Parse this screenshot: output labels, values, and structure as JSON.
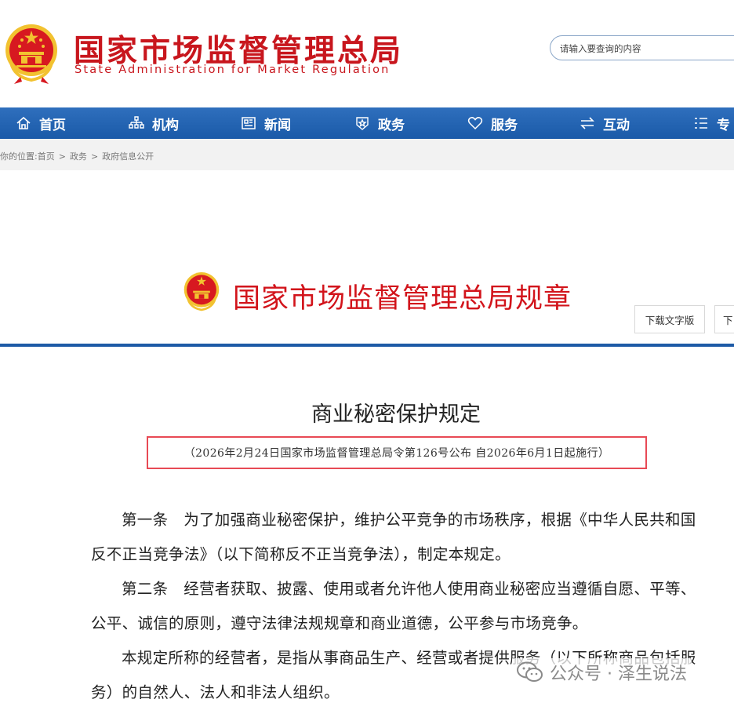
{
  "header": {
    "title": "国家市场监督管理总局",
    "subtitle": "State Administration for Market Regulation",
    "search": {
      "placeholder": "请输入要查询的内容"
    }
  },
  "nav": {
    "items": [
      {
        "label": "首页",
        "icon": "home-icon"
      },
      {
        "label": "机构",
        "icon": "org-chart-icon"
      },
      {
        "label": "新闻",
        "icon": "newspaper-icon"
      },
      {
        "label": "政务",
        "icon": "badge-icon"
      },
      {
        "label": "服务",
        "icon": "heart-icon"
      },
      {
        "label": "互动",
        "icon": "exchange-icon"
      },
      {
        "label": "专",
        "icon": "list-icon"
      }
    ]
  },
  "breadcrumb": {
    "prefix": "你的位置:",
    "items": [
      "首页",
      "政务",
      "政府信息公开"
    ],
    "separator": ">"
  },
  "rules_banner": {
    "title": "国家市场监督管理总局规章",
    "download_text_label": "下载文字版",
    "download_other_label": "下"
  },
  "document": {
    "title": "商业秘密保护规定",
    "meta": "（2026年2月24日国家市场监督管理总局令第126号公布  自2026年6月1日起施行）",
    "paragraphs": [
      "第一条　为了加强商业秘密保护，维护公平竞争的市场秩序，根据《中华人民共和国反不正当竞争法》（以下简称反不正当竞争法），制定本规定。",
      "第二条　经营者获取、披露、使用或者允许他人使用商业秘密应当遵循自愿、平等、公平、诚信的原则，遵守法律法规规章和商业道德，公平参与市场竞争。",
      "本规定所称的经营者，是指从事商品生产、经营或者提供服务（以下所称商品包括服务）的自然人、法人和非法人组织。"
    ]
  },
  "watermark": {
    "text": "公众号 · 泽生说法",
    "icon": "wechat-icon"
  },
  "colors": {
    "brand_red": "#c8161d",
    "nav_blue": "#1a5aa8",
    "highlight_box": "#e84a55",
    "emblem_gold": "#f2c230"
  }
}
